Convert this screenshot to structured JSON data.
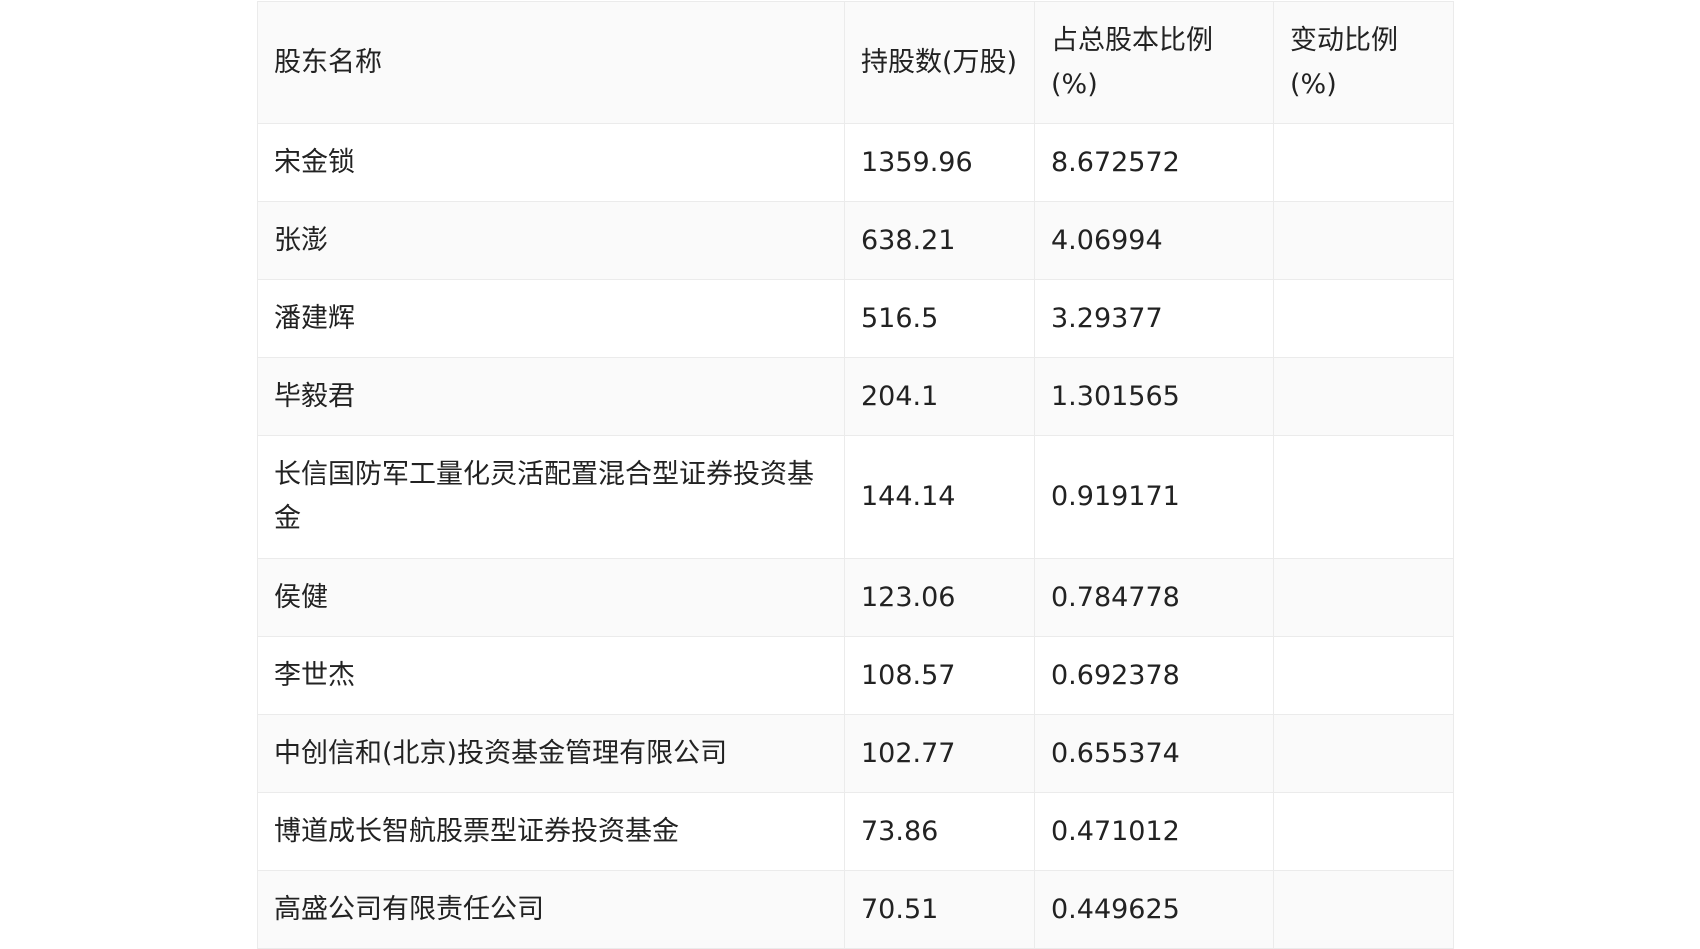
{
  "table": {
    "headers": [
      "股东名称",
      "持股数(万股)",
      "占总股本比例(%)",
      "变动比例(%)"
    ],
    "rows": [
      {
        "name": "宋金锁",
        "shares": "1359.96",
        "ratio": "8.672572",
        "change": ""
      },
      {
        "name": "张澎",
        "shares": "638.21",
        "ratio": "4.06994",
        "change": ""
      },
      {
        "name": "潘建辉",
        "shares": "516.5",
        "ratio": "3.29377",
        "change": ""
      },
      {
        "name": "毕毅君",
        "shares": "204.1",
        "ratio": "1.301565",
        "change": ""
      },
      {
        "name": "长信国防军工量化灵活配置混合型证券投资基金",
        "shares": "144.14",
        "ratio": "0.919171",
        "change": ""
      },
      {
        "name": "侯健",
        "shares": "123.06",
        "ratio": "0.784778",
        "change": ""
      },
      {
        "name": "李世杰",
        "shares": "108.57",
        "ratio": "0.692378",
        "change": ""
      },
      {
        "name": "中创信和(北京)投资基金管理有限公司",
        "shares": "102.77",
        "ratio": "0.655374",
        "change": ""
      },
      {
        "name": "博道成长智航股票型证券投资基金",
        "shares": "73.86",
        "ratio": "0.471012",
        "change": ""
      },
      {
        "name": "高盛公司有限责任公司",
        "shares": "70.51",
        "ratio": "0.449625",
        "change": ""
      }
    ]
  }
}
